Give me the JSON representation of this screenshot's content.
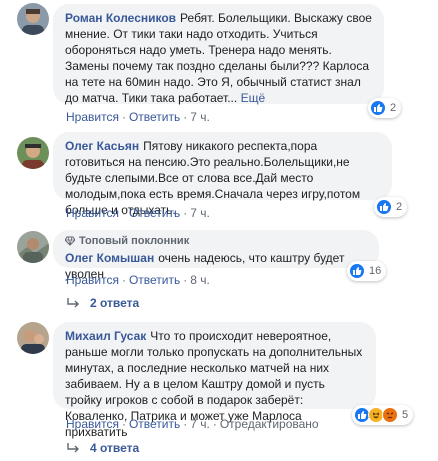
{
  "comments": [
    {
      "author": "Роман Колесников",
      "text": "Ребят. Болельщики. Выскажу свое мнение. От тики таки надо отходить. Учиться обороняться надо уметь. Тренера надо менять. Замены почему так поздно сделаны были??? Карлоса на тете на 60мин надо. Это Я, обычный статист знал до матча. Тики така работает...",
      "more": "Ещё",
      "reactions": {
        "count": "2",
        "icons": [
          "like-icon"
        ]
      },
      "actions": {
        "like": "Нравится",
        "reply": "Ответить",
        "time": "7 ч."
      }
    },
    {
      "author": "Олег Касьян",
      "text": "Пятову никакого респекта,пора готовиться на пенсию.Это реально.Болельщики,не будьте слепыми.Все от слова все.Дай место молодым,пока есть время.Сначала через игру,потом больше и отдыхать.",
      "reactions": {
        "count": "2",
        "icons": [
          "like-icon"
        ]
      },
      "actions": {
        "like": "Нравится",
        "reply": "Ответить",
        "time": "7 ч."
      }
    },
    {
      "badge": "Топовый поклонник",
      "author": "Олег Комышан",
      "text": "очень надеюсь, что каштру будет уволен",
      "reactions": {
        "count": "16",
        "icons": [
          "like-icon"
        ]
      },
      "actions": {
        "like": "Нравится",
        "reply": "Ответить",
        "time": "8 ч."
      },
      "replies": "2 ответа"
    },
    {
      "author": "Михаил Гусак",
      "text": "Что то происходит невероятное, раньше могли только пропускать на дополнительных минутах, а последние несколько матчей на них забиваем. Ну а в целом Каштру домой и пусть тройку игроков с собой в подарок заберёт: Коваленко, Патрика и может уже Марлоса прихватить",
      "reactions": {
        "count": "5",
        "icons": [
          "like-icon",
          "haha-icon",
          "angry-icon"
        ]
      },
      "actions": {
        "like": "Нравится",
        "reply": "Ответить",
        "time": "7 ч.",
        "edited": "Отредактировано"
      },
      "replies": "4 ответа"
    }
  ],
  "colors": {
    "link": "#385898",
    "bubble": "#f2f3f5",
    "like": "#1877f2",
    "meta": "#606770"
  }
}
